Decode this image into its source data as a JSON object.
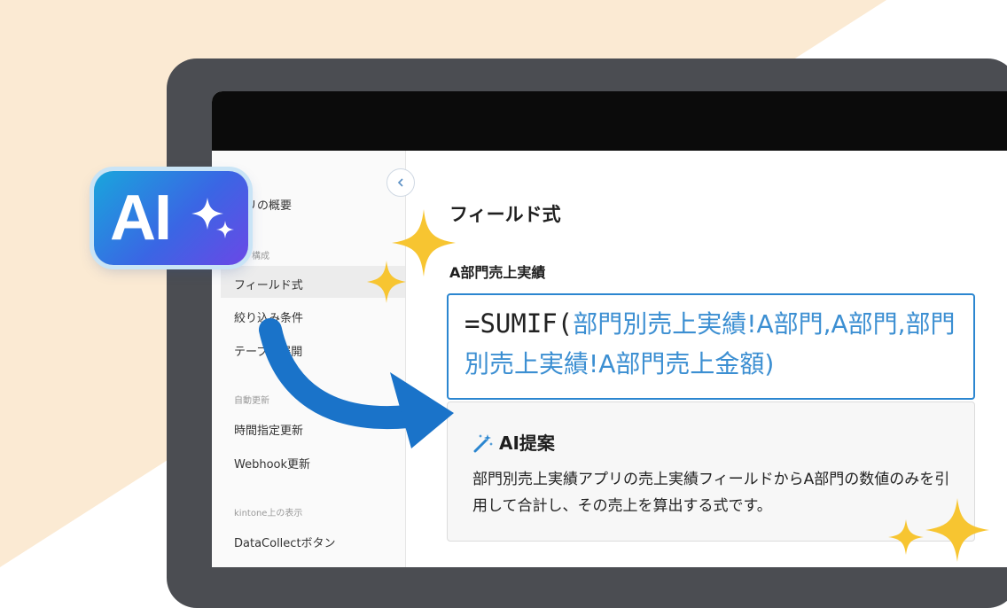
{
  "background": {
    "accent_color": "#fbead3"
  },
  "badge": {
    "label": "AI"
  },
  "sidebar": {
    "items": [
      {
        "label": "プリの概要"
      },
      {
        "label": "フィールド式"
      },
      {
        "label": "絞り込み条件"
      },
      {
        "label": "テーブル展開"
      },
      {
        "label": "時間指定更新"
      },
      {
        "label": "Webhook更新"
      },
      {
        "label": "DataCollectボタン"
      }
    ],
    "sections": [
      {
        "label": "構成"
      },
      {
        "label": "自動更新"
      },
      {
        "label": "kintone上の表示"
      }
    ]
  },
  "main": {
    "title": "フィールド式",
    "field_label": "A部門売上実績",
    "formula": {
      "prefix": "=SUMIF(",
      "refs": "部門別売上実績!A部門,A部門,部門別売上実績!A部門売上金額)"
    }
  },
  "ai_suggestion": {
    "title": "AI提案",
    "body": "部門別売上実績アプリの売上実績フィールドからA部門の数値のみを引用して合計し、その売上を算出する式です。"
  },
  "colors": {
    "accent": "#2b86d0",
    "sparkle": "#f7c531",
    "arrow": "#1a73c9"
  }
}
